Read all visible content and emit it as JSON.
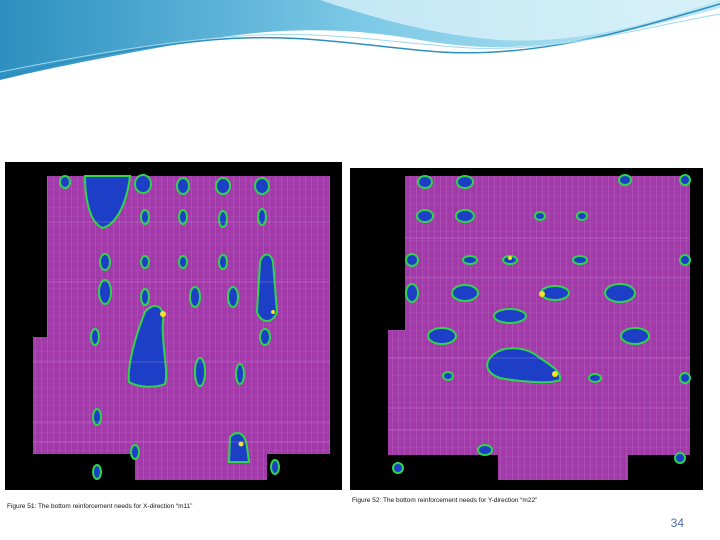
{
  "slide": {
    "figures": [
      {
        "caption": "Figure 51: The bottom reinforcement needs for X-direction “m11”",
        "colors": {
          "background": "#000000",
          "field": "#a23aaa",
          "blob": "#1d3fc8",
          "edge": "#2fd64a",
          "hot": "#f4e12a"
        }
      },
      {
        "caption": "Figure 52: The bottom reinforcement needs for Y-direction “m22”",
        "colors": {
          "background": "#000000",
          "field": "#a23aaa",
          "blob": "#1d3fc8",
          "edge": "#2fd64a",
          "hot": "#f4e12a"
        }
      }
    ],
    "page_number": "34",
    "accent_colors": {
      "wave_light": "#bfe8f4",
      "wave_mid": "#6fc3e3",
      "wave_dark": "#2c8fbf",
      "page_number": "#4a6fb0"
    }
  }
}
